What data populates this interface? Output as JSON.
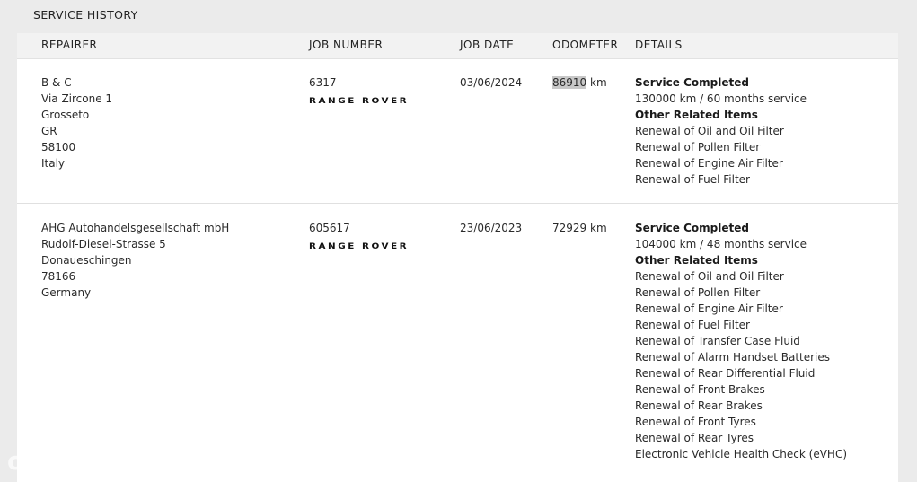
{
  "section": {
    "title": "SERVICE HISTORY"
  },
  "columns": {
    "repairer": "REPAIRER",
    "job_number": "JOB NUMBER",
    "job_date": "JOB DATE",
    "odometer": "ODOMETER",
    "details": "DETAILS"
  },
  "records": [
    {
      "repairer": [
        "B & C",
        "Via Zircone 1",
        "Grosseto",
        "GR",
        "58100",
        "Italy"
      ],
      "job_number": "6317",
      "brand": "RANGE ROVER",
      "job_date": "03/06/2024",
      "odometer_value": "86910",
      "odometer_unit": "km",
      "service_heading": "Service Completed",
      "service_desc": "130000 km / 60 months service",
      "other_heading": "Other Related Items",
      "items": [
        "Renewal of Oil and Oil Filter",
        "Renewal of Pollen Filter",
        "Renewal of Engine Air Filter",
        "Renewal of Fuel Filter"
      ]
    },
    {
      "repairer": [
        "AHG Autohandelsgesellschaft mbH",
        "Rudolf-Diesel-Strasse 5",
        "Donaueschingen",
        "78166",
        "Germany"
      ],
      "job_number": "605617",
      "brand": "RANGE ROVER",
      "job_date": "23/06/2023",
      "odometer_value": "72929",
      "odometer_unit": "km",
      "service_heading": "Service Completed",
      "service_desc": "104000 km / 48 months service",
      "other_heading": "Other Related Items",
      "items": [
        "Renewal of Oil and Oil Filter",
        "Renewal of Pollen Filter",
        "Renewal of Engine Air Filter",
        "Renewal of Fuel Filter",
        "Renewal of Transfer Case Fluid",
        "Renewal of Alarm Handset Batteries",
        "Renewal of Rear Differential Fluid",
        "Renewal of Front Brakes",
        "Renewal of Rear Brakes",
        "Renewal of Front Tyres",
        "Renewal of Rear Tyres",
        "Electronic Vehicle Health Check (eVHC)"
      ]
    }
  ],
  "watermark": "otomoto"
}
